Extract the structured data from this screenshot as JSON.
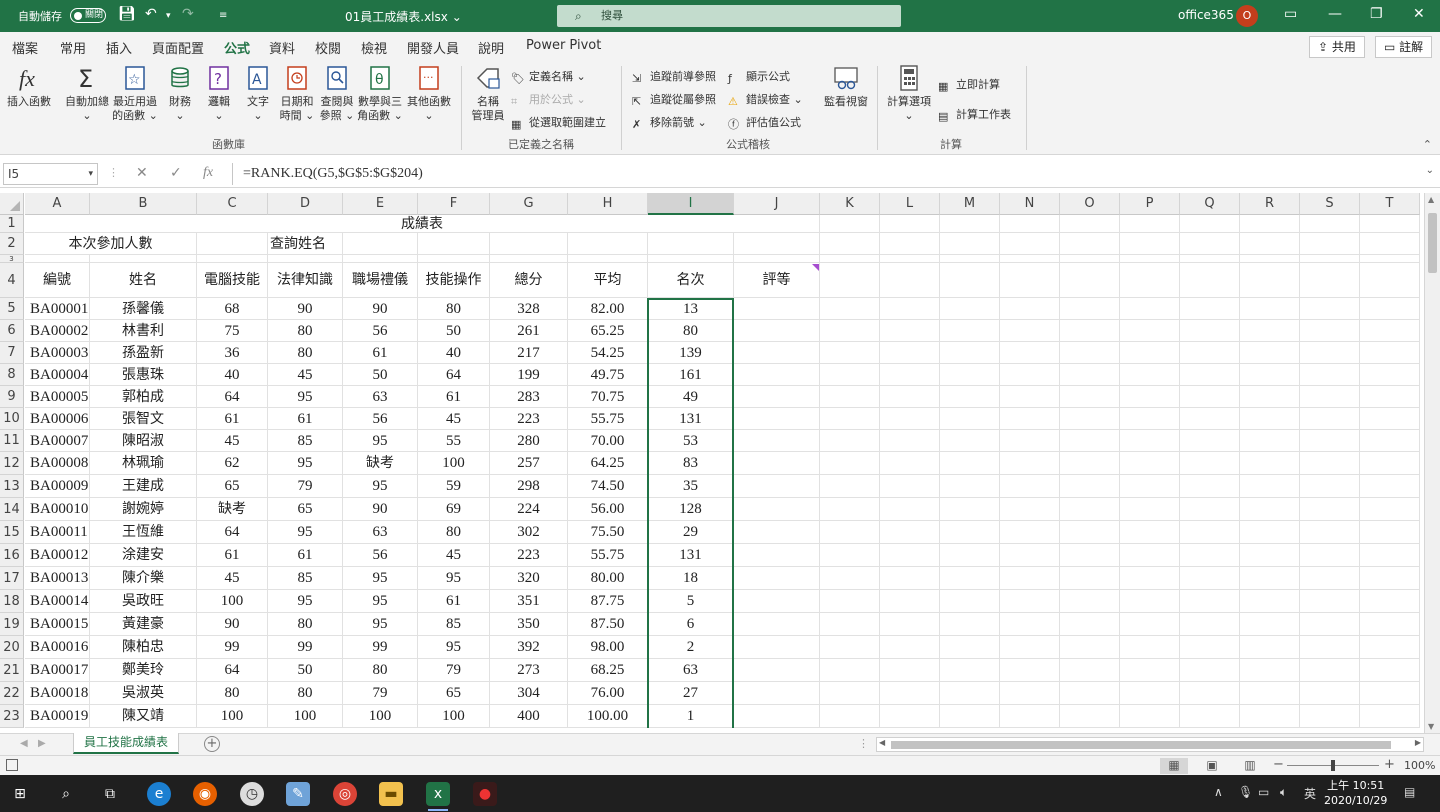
{
  "title_bar": {
    "autosave_label": "自動儲存",
    "autosave_state": "關閉",
    "filename": "01員工成績表.xlsx",
    "search_placeholder": "搜尋",
    "account": "office365",
    "avatar_letter": "O"
  },
  "ribbon_tabs": [
    "檔案",
    "常用",
    "插入",
    "頁面配置",
    "公式",
    "資料",
    "校閱",
    "檢視",
    "開發人員",
    "說明",
    "Power Pivot"
  ],
  "active_tab": "公式",
  "share_label": "共用",
  "comment_label": "註解",
  "ribbon": {
    "function_library": {
      "group_label": "函數庫",
      "insert_function": "插入函數",
      "autosum": [
        "自動加總",
        "⌄"
      ],
      "recent": [
        "最近用過",
        "的函數 ⌄"
      ],
      "financial": [
        "財務",
        "⌄"
      ],
      "logical": [
        "邏輯",
        "⌄"
      ],
      "text": [
        "文字",
        "⌄"
      ],
      "datetime": [
        "日期和",
        "時間 ⌄"
      ],
      "lookup": [
        "查閱與",
        "參照 ⌄"
      ],
      "math": [
        "數學與三",
        "角函數 ⌄"
      ],
      "more": [
        "其他函數",
        "⌄"
      ]
    },
    "defined_names": {
      "group_label": "已定義之名稱",
      "name_manager": [
        "名稱",
        "管理員"
      ],
      "define_name": "定義名稱 ⌄",
      "use_in_formula": "用於公式 ⌄",
      "create_from_selection": "從選取範圍建立"
    },
    "formula_auditing": {
      "group_label": "公式稽核",
      "trace_precedents": "追蹤前導參照",
      "trace_dependents": "追蹤從屬參照",
      "remove_arrows": "移除箭號 ⌄",
      "show_formulas": "顯示公式",
      "error_checking": "錯誤檢查 ⌄",
      "evaluate_formula": "評估值公式",
      "watch_window": "監看視窗"
    },
    "calculation": {
      "group_label": "計算",
      "calc_options": [
        "計算選項",
        "⌄"
      ],
      "calc_now": "立即計算",
      "calc_sheet": "計算工作表"
    }
  },
  "formula_bar": {
    "name_box": "I5",
    "formula": "=RANK.EQ(G5,$G$5:$G$204)"
  },
  "columns": [
    "A",
    "B",
    "C",
    "D",
    "E",
    "F",
    "G",
    "H",
    "I",
    "J",
    "K",
    "L",
    "M",
    "N",
    "O",
    "P",
    "Q",
    "R",
    "S",
    "T"
  ],
  "selected_column": "I",
  "sheet": {
    "title": "成績表",
    "participants_label": "本次參加人數",
    "query_label": "查詢姓名",
    "headers": [
      "編號",
      "姓名",
      "電腦技能",
      "法律知識",
      "職場禮儀",
      "技能操作",
      "總分",
      "平均",
      "名次",
      "評等"
    ],
    "rows": [
      [
        "BA00001",
        "孫馨儀",
        "68",
        "90",
        "90",
        "80",
        "328",
        "82.00",
        "13"
      ],
      [
        "BA00002",
        "林書利",
        "75",
        "80",
        "56",
        "50",
        "261",
        "65.25",
        "80"
      ],
      [
        "BA00003",
        "孫盈新",
        "36",
        "80",
        "61",
        "40",
        "217",
        "54.25",
        "139"
      ],
      [
        "BA00004",
        "張惠珠",
        "40",
        "45",
        "50",
        "64",
        "199",
        "49.75",
        "161"
      ],
      [
        "BA00005",
        "郭柏成",
        "64",
        "95",
        "63",
        "61",
        "283",
        "70.75",
        "49"
      ],
      [
        "BA00006",
        "張智文",
        "61",
        "61",
        "56",
        "45",
        "223",
        "55.75",
        "131"
      ],
      [
        "BA00007",
        "陳昭淑",
        "45",
        "85",
        "95",
        "55",
        "280",
        "70.00",
        "53"
      ],
      [
        "BA00008",
        "林珮瑜",
        "62",
        "95",
        "缺考",
        "100",
        "257",
        "64.25",
        "83"
      ],
      [
        "BA00009",
        "王建成",
        "65",
        "79",
        "95",
        "59",
        "298",
        "74.50",
        "35"
      ],
      [
        "BA00010",
        "謝婉婷",
        "缺考",
        "65",
        "90",
        "69",
        "224",
        "56.00",
        "128"
      ],
      [
        "BA00011",
        "王恆維",
        "64",
        "95",
        "63",
        "80",
        "302",
        "75.50",
        "29"
      ],
      [
        "BA00012",
        "涂建安",
        "61",
        "61",
        "56",
        "45",
        "223",
        "55.75",
        "131"
      ],
      [
        "BA00013",
        "陳介樂",
        "45",
        "85",
        "95",
        "95",
        "320",
        "80.00",
        "18"
      ],
      [
        "BA00014",
        "吳政旺",
        "100",
        "95",
        "95",
        "61",
        "351",
        "87.75",
        "5"
      ],
      [
        "BA00015",
        "黃建豪",
        "90",
        "80",
        "95",
        "85",
        "350",
        "87.50",
        "6"
      ],
      [
        "BA00016",
        "陳柏忠",
        "99",
        "99",
        "99",
        "95",
        "392",
        "98.00",
        "2"
      ],
      [
        "BA00017",
        "鄭美玲",
        "64",
        "50",
        "80",
        "79",
        "273",
        "68.25",
        "63"
      ],
      [
        "BA00018",
        "吳淑英",
        "80",
        "80",
        "79",
        "65",
        "304",
        "76.00",
        "27"
      ],
      [
        "BA00019",
        "陳又靖",
        "100",
        "100",
        "100",
        "100",
        "400",
        "100.00",
        "1"
      ]
    ]
  },
  "sheet_tab": "員工技能成績表",
  "status": {
    "zoom": "100%",
    "zoom_fraction": 0.5
  },
  "taskbar": {
    "time": "上午 10:51",
    "date": "2020/10/29",
    "ime": "英"
  },
  "colors": {
    "excel_green": "#217346",
    "accent_purple": "#a64dcf"
  }
}
